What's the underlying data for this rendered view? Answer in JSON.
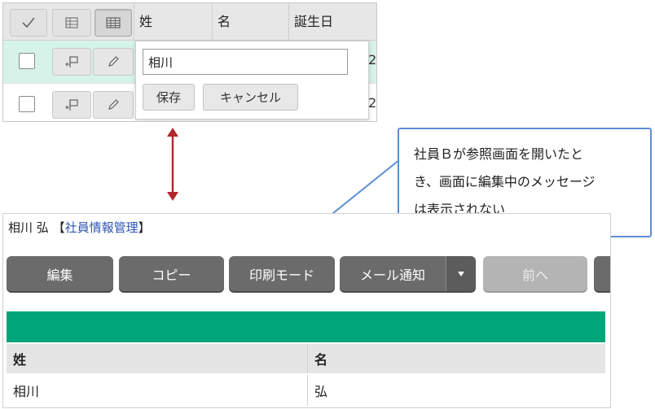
{
  "grid": {
    "columns": [
      "姓",
      "名",
      "誕生日"
    ],
    "row_trailing_char": "2",
    "edit_popup": {
      "input_value": "相川",
      "save_label": "保存",
      "cancel_label": "キャンセル"
    }
  },
  "callout": {
    "lines": [
      "社員Ｂが参照画面を開いたと",
      "き、画面に編集中のメッセージ",
      "は表示されない"
    ]
  },
  "record": {
    "title_prefix": "相川 弘",
    "bracket_open": "【",
    "app_name": "社員情報管理",
    "bracket_close": "】",
    "toolbar": {
      "edit": "編集",
      "copy": "コピー",
      "print_mode": "印刷モード",
      "mail_notify": "メール通知",
      "prev": "前へ"
    },
    "table": {
      "headers": [
        "姓",
        "名"
      ],
      "row": [
        "相川",
        "弘"
      ]
    }
  },
  "colors": {
    "accent_green": "#00a57a",
    "selected_row": "#d6f3ea",
    "arrow_red": "#b3262b",
    "callout_border": "#5b8fd1",
    "toolbar_button": "#6b6b6b",
    "link_blue": "#2d54b3"
  },
  "icons": {
    "header_1": "checkmark-icon",
    "header_2": "table-icon",
    "header_3": "table-detail-icon",
    "row_1": "comment-flag-icon",
    "row_2": "pencil-icon",
    "split": "caret-down-icon"
  }
}
